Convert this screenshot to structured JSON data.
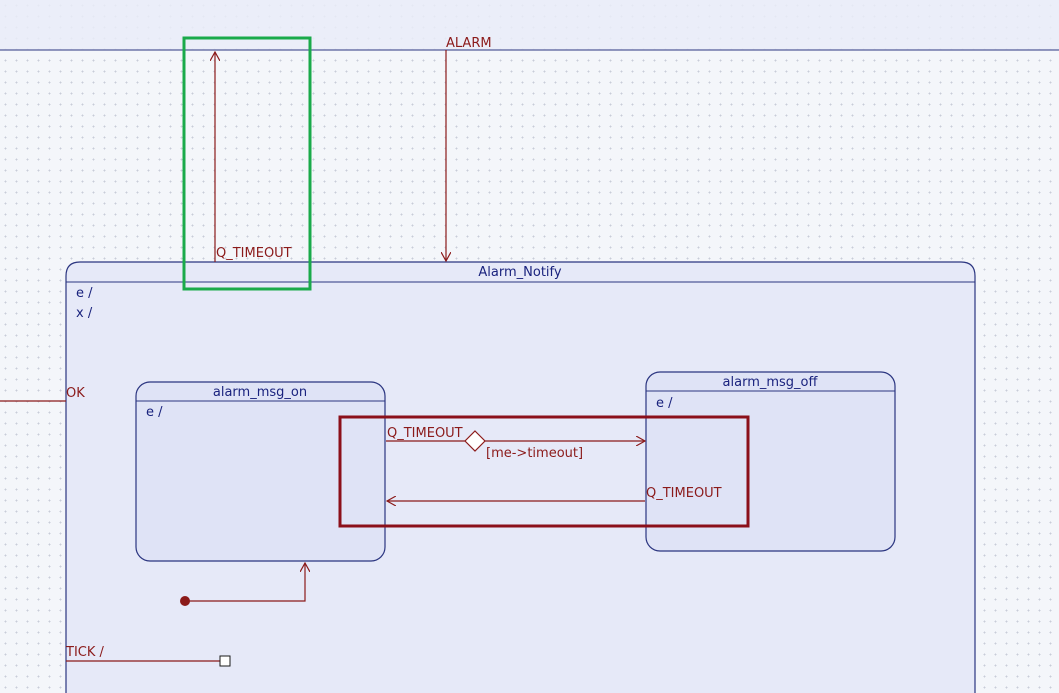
{
  "diagram": {
    "outer_state": {
      "name": "Alarm_Notify",
      "entry": "e /",
      "exit": "x /"
    },
    "state_on": {
      "name": "alarm_msg_on",
      "entry": "e /"
    },
    "state_off": {
      "name": "alarm_msg_off",
      "entry": "e /"
    },
    "transitions": {
      "alarm": "ALARM",
      "q_timeout_up": "Q_TIMEOUT",
      "ok": "OK",
      "q_timeout_forward": "Q_TIMEOUT",
      "guard": "[me->timeout]",
      "q_timeout_back": "Q_TIMEOUT",
      "tick": "TICK /"
    },
    "colors": {
      "state_border": "#2b3580",
      "state_fill": "#e6e9f8",
      "transition": "#8b1a1a",
      "highlight_green": "#1aaa4a",
      "highlight_red": "#8b0f1a"
    }
  }
}
